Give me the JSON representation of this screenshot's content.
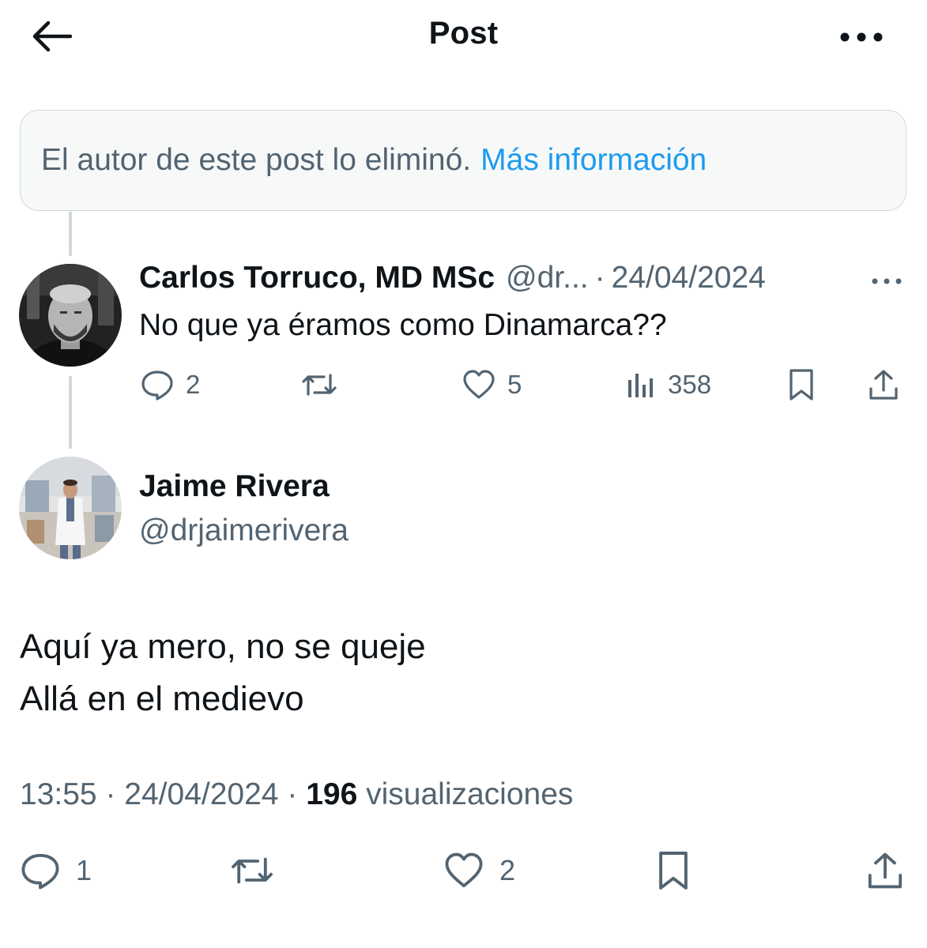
{
  "header": {
    "title": "Post",
    "back_icon": "arrow-left-icon",
    "more_icon": "more-horizontal-icon"
  },
  "deleted_notice": {
    "text": "El autor de este post lo eliminó.",
    "link": "Más información"
  },
  "reply": {
    "name": "Carlos Torruco, MD MSc",
    "handle": "@dr...",
    "separator": "·",
    "date": "24/04/2024",
    "text": "No que ya éramos como Dinamarca??",
    "actions": {
      "replies": "2",
      "likes": "5",
      "views": "358"
    }
  },
  "main": {
    "name": "Jaime Rivera",
    "handle": "@drjaimerivera",
    "lines": [
      "Aquí ya mero, no se queje",
      "Allá en el medievo"
    ],
    "time": "13:55",
    "sep1": "·",
    "date": "24/04/2024",
    "sep2": "·",
    "views_count": "196",
    "views_label": "visualizaciones",
    "actions": {
      "replies": "1",
      "likes": "2"
    }
  },
  "colors": {
    "text": "#0f1419",
    "secondary": "#536471",
    "link": "#1d9bf0",
    "border": "#cfd9de",
    "notice_bg": "#f7f9f9"
  }
}
